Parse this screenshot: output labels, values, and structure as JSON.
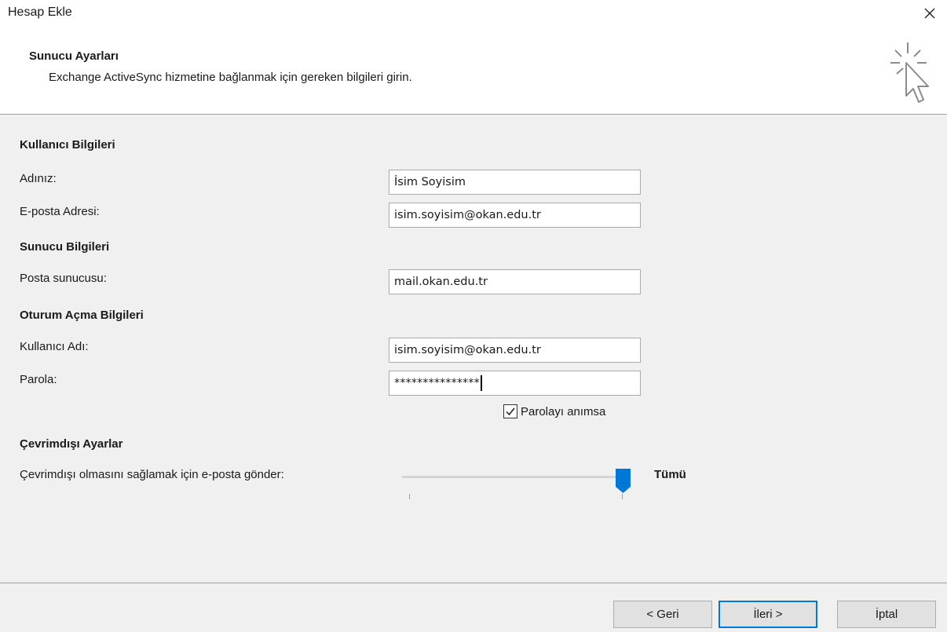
{
  "window": {
    "title": "Hesap Ekle"
  },
  "header": {
    "title": "Sunucu Ayarları",
    "description": "Exchange ActiveSync hizmetine bağlanmak için gereken bilgileri girin."
  },
  "user_info": {
    "heading": "Kullanıcı Bilgileri",
    "name_label": "Adınız:",
    "name_value": "İsim Soyisim",
    "email_label": "E-posta Adresi:",
    "email_value": "isim.soyisim@okan.edu.tr"
  },
  "server_info": {
    "heading": "Sunucu Bilgileri",
    "server_label": "Posta sunucusu:",
    "server_value": "mail.okan.edu.tr"
  },
  "logon_info": {
    "heading": "Oturum Açma Bilgileri",
    "username_label": "Kullanıcı Adı:",
    "username_value": "isim.soyisim@okan.edu.tr",
    "password_label": "Parola:",
    "password_value": "***************",
    "remember_label": "Parolayı anımsa",
    "remember_checked": true
  },
  "offline": {
    "heading": "Çevrimdışı Ayarlar",
    "slider_label": "Çevrimdışı olmasını sağlamak için e-posta gönder:",
    "slider_value": "Tümü",
    "slider_position": 1.0
  },
  "buttons": {
    "back": "< Geri",
    "next": "İleri >",
    "cancel": "İptal"
  },
  "colors": {
    "accent": "#0078d7",
    "background": "#f0f0f0"
  }
}
